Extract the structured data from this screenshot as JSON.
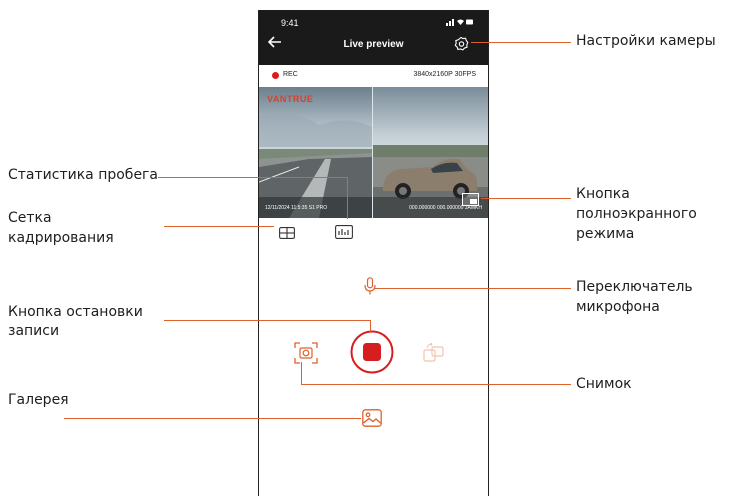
{
  "status_bar": {
    "time": "9:41",
    "icons": "signal-wifi-battery-icons"
  },
  "header": {
    "title": "Live preview",
    "back_icon": "arrow-left-icon",
    "settings_icon": "gear-icon"
  },
  "recording": {
    "rec_label": "REC",
    "resolution": "3840x2160P 30FPS"
  },
  "video": {
    "brand": "VANTRUE",
    "osd_left": "12/11/2024  11:5:35   S1 PRO",
    "osd_right": "000.000000   000.000000   3AMKH"
  },
  "callouts": {
    "camera_settings": "Настройки камеры",
    "mileage_stats": "Статистика пробега",
    "crop_grid_line1": "Сетка",
    "crop_grid_line2": "кадрирования",
    "fullscreen_line1": "Кнопка",
    "fullscreen_line2": "полноэкранного",
    "fullscreen_line3": "режима",
    "mic_line1": "Переключатель",
    "mic_line2": "микрофона",
    "stop_line1": "Кнопка остановки",
    "stop_line2": "записи",
    "snapshot": "Снимок",
    "gallery": "Галерея"
  },
  "colors": {
    "accent": "#e0602c",
    "record_red": "#d71e1e",
    "header_bg": "#1a1a1a"
  }
}
